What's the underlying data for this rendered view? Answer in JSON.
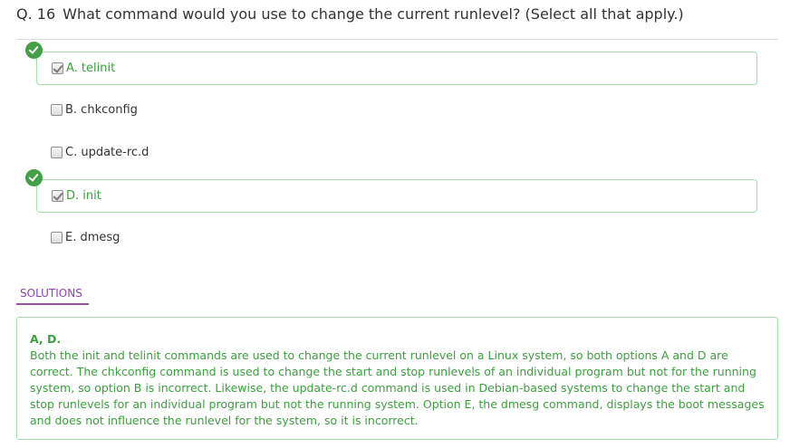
{
  "question": {
    "number": "Q. 16",
    "text": "What command would you use to change the current runlevel? (Select all that apply.)"
  },
  "options": [
    {
      "label": "A. telinit",
      "checked": true,
      "correct": true
    },
    {
      "label": "B. chkconfig",
      "checked": false,
      "correct": false
    },
    {
      "label": "C. update-rc.d",
      "checked": false,
      "correct": false
    },
    {
      "label": "D. init",
      "checked": true,
      "correct": true
    },
    {
      "label": "E. dmesg",
      "checked": false,
      "correct": false
    }
  ],
  "solutions": {
    "tab_label": "SOLUTIONS",
    "answer": "A, D.",
    "explanation": "Both the init and telinit commands are used to change the current runlevel on a Linux system, so both options A and D are correct. The chkconfig command is used to change the start and stop runlevels of an individual program but not for the running system, so option B is incorrect. Likewise, the update-rc.d command is used in Debian-based systems to change the start and stop runlevels for an individual program but not the running system. Option E, the dmesg command, displays the boot messages and does not influence the runlevel for the system, so it is incorrect."
  },
  "colors": {
    "correct_green": "#3c9f3f",
    "correct_border": "#a5dfa8",
    "tab_purple": "#8e44ad"
  },
  "icons": {
    "correct": "check-circle-icon",
    "checked_box": "checkmark-icon"
  }
}
